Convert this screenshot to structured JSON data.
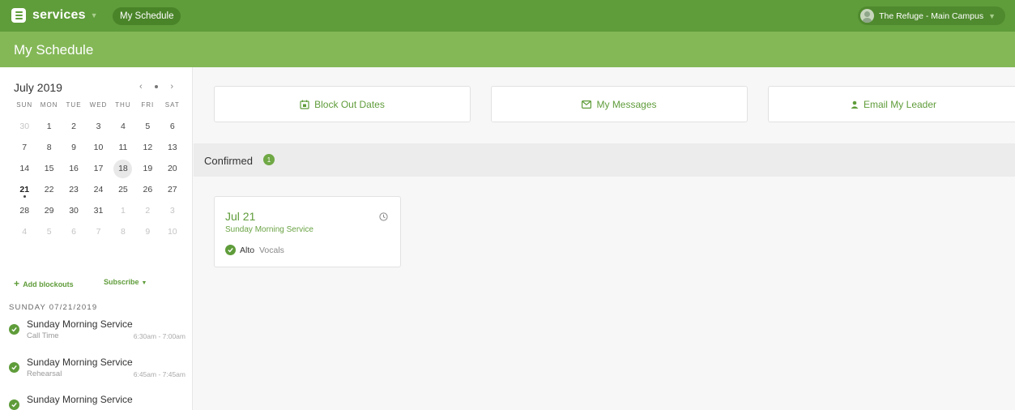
{
  "topbar": {
    "app_name": "services",
    "nav_pill": "My Schedule",
    "campus": "The Refuge - Main Campus",
    "brand_color": "#5f9c3a"
  },
  "page": {
    "title": "My Schedule",
    "header_color": "#84b857"
  },
  "calendar": {
    "month_label": "July 2019",
    "weekdays": [
      "SUN",
      "MON",
      "TUE",
      "WED",
      "THU",
      "FRI",
      "SAT"
    ],
    "weeks": [
      [
        "30",
        "1",
        "2",
        "3",
        "4",
        "5",
        "6"
      ],
      [
        "7",
        "8",
        "9",
        "10",
        "11",
        "12",
        "13"
      ],
      [
        "14",
        "15",
        "16",
        "17",
        "18",
        "19",
        "20"
      ],
      [
        "21",
        "22",
        "23",
        "24",
        "25",
        "26",
        "27"
      ],
      [
        "28",
        "29",
        "30",
        "31",
        "1",
        "2",
        "3"
      ],
      [
        "4",
        "5",
        "6",
        "7",
        "8",
        "9",
        "10"
      ]
    ],
    "today": "18",
    "scheduled_day": "21"
  },
  "sidebar": {
    "add_blockouts": "Add blockouts",
    "subscribe": "Subscribe",
    "day_label": "SUNDAY 07/21/2019",
    "events": [
      {
        "title": "Sunday Morning Service",
        "subtitle": "Call Time",
        "time": "6:30am - 7:00am"
      },
      {
        "title": "Sunday Morning Service",
        "subtitle": "Rehearsal",
        "time": "6:45am - 7:45am"
      },
      {
        "title": "Sunday Morning Service",
        "subtitle": "",
        "time": ""
      }
    ]
  },
  "actions": {
    "block_out": "Block Out Dates",
    "messages": "My Messages",
    "email_leader": "Email My Leader"
  },
  "confirmed": {
    "label": "Confirmed",
    "count": "1",
    "card": {
      "date": "Jul 21",
      "service": "Sunday Morning Service",
      "position": "Alto",
      "team": "Vocals"
    }
  }
}
